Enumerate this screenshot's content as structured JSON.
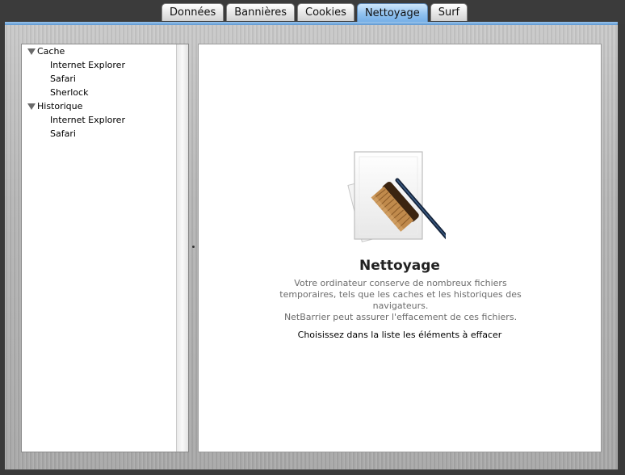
{
  "tabs": [
    {
      "label": "Données",
      "active": false
    },
    {
      "label": "Bannières",
      "active": false
    },
    {
      "label": "Cookies",
      "active": false
    },
    {
      "label": "Nettoyage",
      "active": true
    },
    {
      "label": "Surf",
      "active": false
    }
  ],
  "sidebar": {
    "groups": [
      {
        "label": "Cache",
        "items": [
          "Internet Explorer",
          "Safari",
          "Sherlock"
        ]
      },
      {
        "label": "Historique",
        "items": [
          "Internet Explorer",
          "Safari"
        ]
      }
    ]
  },
  "main": {
    "icon": "broom-document-icon",
    "title": "Nettoyage",
    "description_lines": [
      "Votre ordinateur conserve de nombreux fichiers",
      "temporaires, tels que les caches et les historiques des",
      "navigateurs.",
      "NetBarrier peut assurer l'effacement de ces fichiers."
    ],
    "instruction": "Choisissez dans la liste les éléments à effacer"
  },
  "colors": {
    "accent": "#74aee6",
    "text_muted": "#6c6c6c"
  }
}
